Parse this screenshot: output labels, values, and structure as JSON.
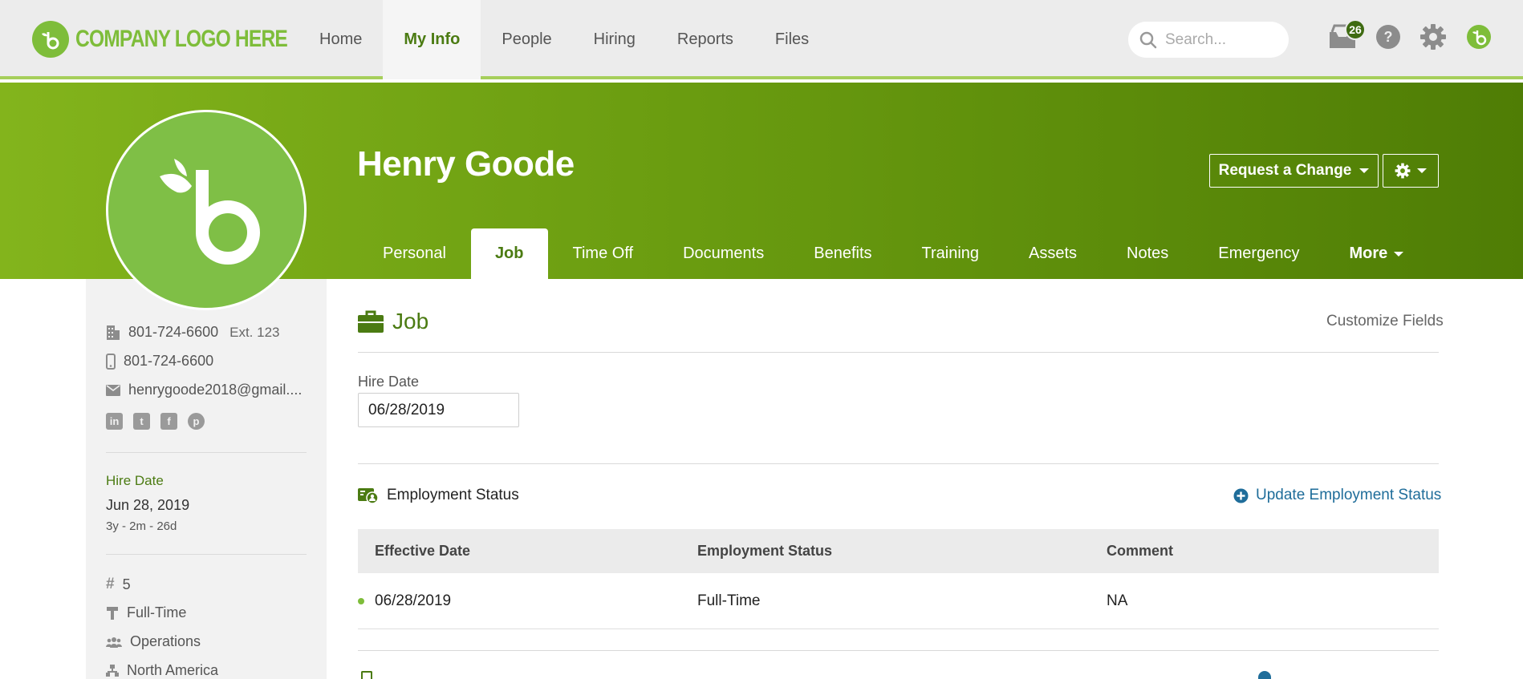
{
  "logo": {
    "text": "COMPANY LOGO HERE"
  },
  "nav": {
    "links": [
      "Home",
      "My Info",
      "People",
      "Hiring",
      "Reports",
      "Files"
    ],
    "active": "My Info"
  },
  "search": {
    "placeholder": "Search..."
  },
  "notifications": {
    "count": "26"
  },
  "icons": [
    "search-icon",
    "inbox-icon",
    "help-icon",
    "settings-gear-icon",
    "user-avatar-icon"
  ],
  "profile": {
    "name": "Henry Goode",
    "request_change_label": "Request a Change"
  },
  "tabs": [
    "Personal",
    "Job",
    "Time Off",
    "Documents",
    "Benefits",
    "Training",
    "Assets",
    "Notes",
    "Emergency"
  ],
  "tabs_active": "Job",
  "tabs_more": "More",
  "sidebar": {
    "work_phone": "801-724-6600",
    "ext": "Ext. 123",
    "mobile_phone": "801-724-6600",
    "email": "henrygoode2018@gmail....",
    "social": [
      "in",
      "t",
      "f",
      "p"
    ],
    "hire_date_label": "Hire Date",
    "hire_date": "Jun 28, 2019",
    "tenure": "3y - 2m - 26d",
    "employee_number": "5",
    "employment_type": "Full-Time",
    "department": "Operations",
    "location": "North America"
  },
  "job": {
    "title": "Job",
    "customize_label": "Customize Fields",
    "hire_date_label": "Hire Date",
    "hire_date_value": "06/28/2019"
  },
  "employment_status": {
    "title": "Employment Status",
    "update_label": "Update Employment Status",
    "columns": [
      "Effective Date",
      "Employment Status",
      "Comment"
    ],
    "rows": [
      {
        "effective_date": "06/28/2019",
        "status": "Full-Time",
        "comment": "NA"
      }
    ]
  },
  "colors": {
    "brand_green": "#7ebd3a",
    "dark_green": "#4b7b12",
    "link_blue": "#1f6d9a"
  }
}
